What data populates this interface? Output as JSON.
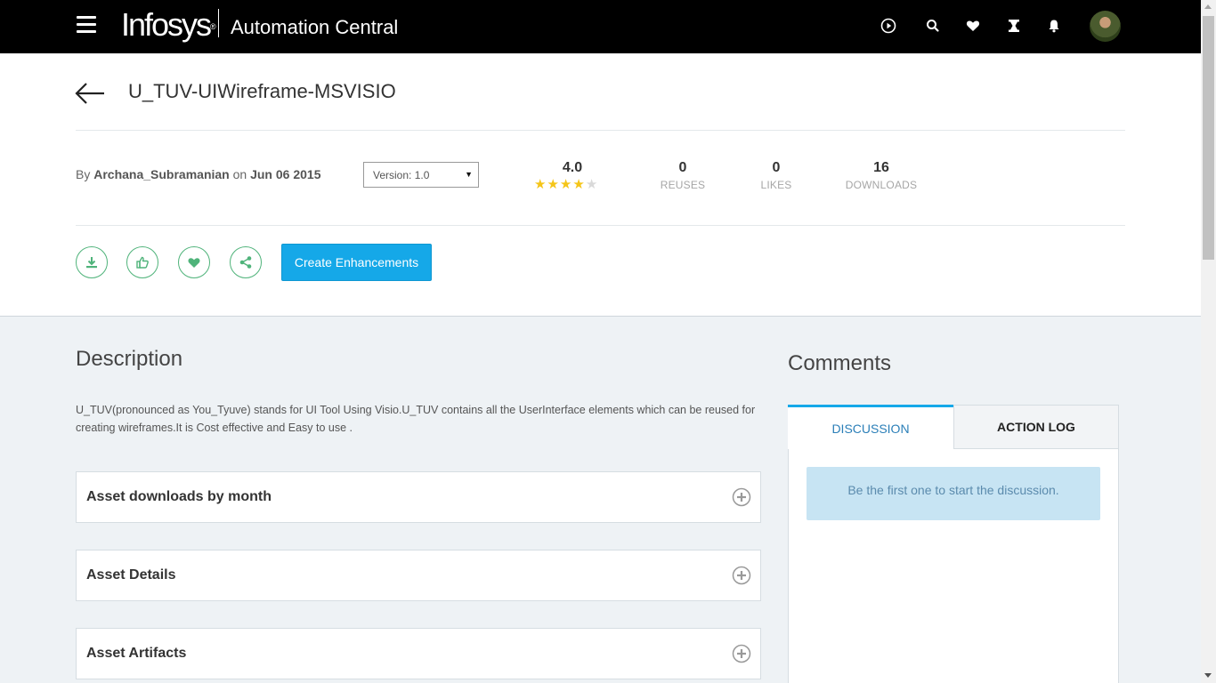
{
  "nav": {
    "brand_logo": "Infosys",
    "brand_mark": "®",
    "product_name": "Automation Central",
    "icons": [
      "play-icon",
      "search-icon",
      "heart-icon",
      "trophy-icon",
      "bell-icon"
    ],
    "avatar": "user-avatar"
  },
  "asset": {
    "title": "U_TUV-UIWireframe-MSVISIO",
    "by_prefix": "By",
    "author": "Archana_Subramanian",
    "on_label": "on",
    "date": "Jun 06 2015",
    "version_label": "Version: 1.0",
    "rating": "4.0",
    "rating_stars": 4,
    "max_stars": 5,
    "reuses": "0",
    "reuses_label": "REUSES",
    "likes": "0",
    "likes_label": "LIKES",
    "downloads": "16",
    "downloads_label": "DOWNLOADS"
  },
  "actions": {
    "create_label": "Create Enhancements",
    "icons": [
      "download-icon",
      "thumbs-up-icon",
      "heart-icon",
      "share-icon"
    ]
  },
  "description": {
    "heading": "Description",
    "text": "U_TUV(pronounced as You_Tyuve) stands for UI Tool Using Visio.U_TUV contains all the UserInterface elements which can be reused for creating wireframes.It is Cost effective and Easy to use ."
  },
  "accordions": [
    {
      "label": "Asset downloads by month"
    },
    {
      "label": "Asset Details"
    },
    {
      "label": "Asset Artifacts"
    }
  ],
  "comments": {
    "heading": "Comments",
    "tabs": [
      "DISCUSSION",
      "ACTION LOG"
    ],
    "empty_message": "Be the first one to start the discussion."
  },
  "colors": {
    "topbar": "#000000",
    "accent": "#15a8e8",
    "action_green": "#4fb37a",
    "star_filled": "#f5c518",
    "star_empty": "#d9d9d9",
    "note_bg": "#c7e4f3"
  }
}
